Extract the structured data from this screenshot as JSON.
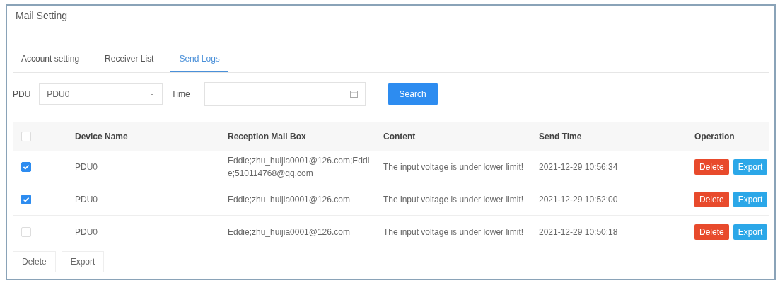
{
  "title": "Mail Setting",
  "tabs": [
    {
      "label": "Account setting",
      "selected": false
    },
    {
      "label": "Receiver List",
      "selected": false
    },
    {
      "label": "Send Logs",
      "selected": true
    }
  ],
  "filters": {
    "pdu_label": "PDU",
    "pdu_value": "PDU0",
    "time_label": "Time",
    "search": "Search"
  },
  "table": {
    "all_checked": false,
    "columns": [
      "Device Name",
      "Reception Mail Box",
      "Content",
      "Send Time",
      "Operation"
    ],
    "rows": [
      {
        "checked": true,
        "device": "PDU0",
        "mailbox": "Eddie;zhu_huijia0001@126.com;Eddie;510114768@qq.com",
        "content": "The input voltage is under lower limit!",
        "time": "2021-12-29 10:56:34",
        "delete": "Delete",
        "export": "Export"
      },
      {
        "checked": true,
        "device": "PDU0",
        "mailbox": "Eddie;zhu_huijia0001@126.com",
        "content": "The input voltage is under lower limit!",
        "time": "2021-12-29 10:52:00",
        "delete": "Delete",
        "export": "Export"
      },
      {
        "checked": false,
        "device": "PDU0",
        "mailbox": "Eddie;zhu_huijia0001@126.com",
        "content": "The input voltage is under lower limit!",
        "time": "2021-12-29 10:50:18",
        "delete": "Delete",
        "export": "Export"
      }
    ]
  },
  "footer_buttons": [
    "Delete",
    "Export"
  ]
}
